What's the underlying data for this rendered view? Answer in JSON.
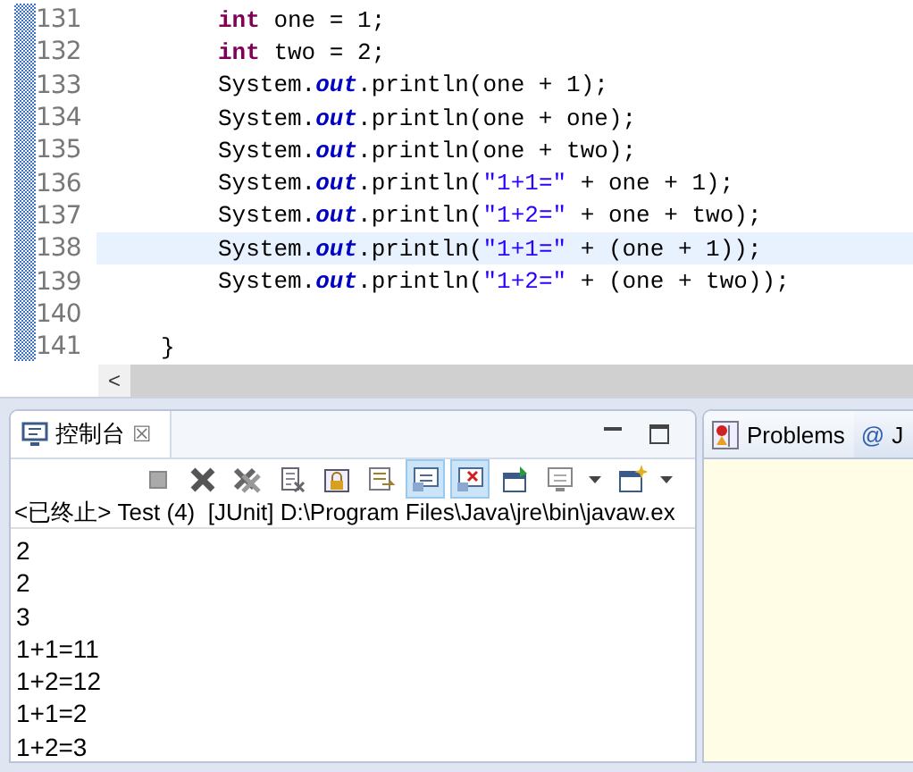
{
  "editor": {
    "lines": [
      {
        "number": "131",
        "current": false,
        "kind": "statement",
        "tokens": [
          {
            "kind": "keyword",
            "text": "int"
          },
          {
            "kind": "plain",
            "text": " one = 1;"
          }
        ]
      },
      {
        "number": "132",
        "current": false,
        "kind": "statement",
        "tokens": [
          {
            "kind": "keyword",
            "text": "int"
          },
          {
            "kind": "plain",
            "text": " two = 2;"
          }
        ]
      },
      {
        "number": "133",
        "current": false,
        "kind": "statement",
        "tokens": [
          {
            "kind": "plain",
            "text": "System."
          },
          {
            "kind": "field",
            "text": "out"
          },
          {
            "kind": "plain",
            "text": ".println(one + 1);"
          }
        ]
      },
      {
        "number": "134",
        "current": false,
        "kind": "statement",
        "tokens": [
          {
            "kind": "plain",
            "text": "System."
          },
          {
            "kind": "field",
            "text": "out"
          },
          {
            "kind": "plain",
            "text": ".println(one + one);"
          }
        ]
      },
      {
        "number": "135",
        "current": false,
        "kind": "statement",
        "tokens": [
          {
            "kind": "plain",
            "text": "System."
          },
          {
            "kind": "field",
            "text": "out"
          },
          {
            "kind": "plain",
            "text": ".println(one + two);"
          }
        ]
      },
      {
        "number": "136",
        "current": false,
        "kind": "statement",
        "tokens": [
          {
            "kind": "plain",
            "text": "System."
          },
          {
            "kind": "field",
            "text": "out"
          },
          {
            "kind": "plain",
            "text": ".println("
          },
          {
            "kind": "string",
            "text": "\"1+1=\""
          },
          {
            "kind": "plain",
            "text": " + one + 1);"
          }
        ]
      },
      {
        "number": "137",
        "current": false,
        "kind": "statement",
        "tokens": [
          {
            "kind": "plain",
            "text": "System."
          },
          {
            "kind": "field",
            "text": "out"
          },
          {
            "kind": "plain",
            "text": ".println("
          },
          {
            "kind": "string",
            "text": "\"1+2=\""
          },
          {
            "kind": "plain",
            "text": " + one + two);"
          }
        ]
      },
      {
        "number": "138",
        "current": true,
        "kind": "statement",
        "tokens": [
          {
            "kind": "plain",
            "text": "System."
          },
          {
            "kind": "field",
            "text": "out"
          },
          {
            "kind": "plain",
            "text": ".println("
          },
          {
            "kind": "string",
            "text": "\"1+1=\""
          },
          {
            "kind": "plain",
            "text": " + (one + 1));"
          }
        ]
      },
      {
        "number": "139",
        "current": false,
        "kind": "statement",
        "tokens": [
          {
            "kind": "plain",
            "text": "System."
          },
          {
            "kind": "field",
            "text": "out"
          },
          {
            "kind": "plain",
            "text": ".println("
          },
          {
            "kind": "string",
            "text": "\"1+2=\""
          },
          {
            "kind": "plain",
            "text": " + (one + two));"
          }
        ]
      },
      {
        "number": "140",
        "current": false
      },
      {
        "number": "141",
        "current": false,
        "kind": "closing",
        "tokens": [
          {
            "kind": "plain",
            "text": "}"
          }
        ]
      }
    ],
    "scroll_left": "<"
  },
  "console": {
    "title": "控制台",
    "close": "☒",
    "toolbar": [
      {
        "kind": "stop",
        "selected": false
      },
      {
        "kind": "remove",
        "selected": false
      },
      {
        "kind": "remove-all",
        "selected": false
      },
      {
        "kind": "clear",
        "selected": false
      },
      {
        "kind": "lock",
        "selected": false
      },
      {
        "kind": "wrap",
        "selected": false
      },
      {
        "kind": "stdout",
        "selected": true
      },
      {
        "kind": "stderr",
        "selected": true
      },
      {
        "kind": "pin",
        "selected": false
      },
      {
        "kind": "display",
        "selected": false
      },
      {
        "kind": "caret",
        "selected": false
      },
      {
        "kind": "new",
        "selected": false
      },
      {
        "kind": "caret",
        "selected": false
      }
    ],
    "status": "<已终止> Test (4)  [JUnit] D:\\Program Files\\Java\\jre\\bin\\javaw.ex",
    "output": [
      "2",
      "2",
      "3",
      "1+1=11",
      "1+2=12",
      "1+1=2",
      "1+2=3"
    ]
  },
  "side_panel": {
    "tabs": [
      {
        "label": "Problems",
        "kind": "problems",
        "selected": true
      },
      {
        "label": "J",
        "icon": "@",
        "kind": "at",
        "selected": false
      }
    ]
  }
}
